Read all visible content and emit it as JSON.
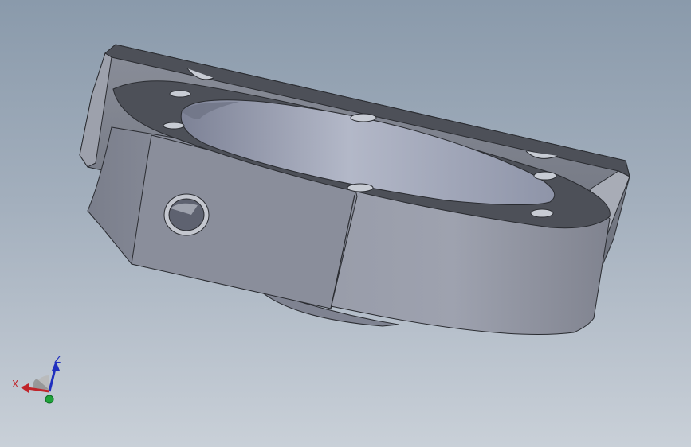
{
  "viewport": {
    "background_top": "#8a9aab",
    "background_bottom": "#c9d0d8"
  },
  "part": {
    "body_color": "#8b8f9c",
    "top_face_color": "#4d5058",
    "bore_color": "#9aa0b3",
    "edge_color": "#2a2c31"
  },
  "triad": {
    "x_label": "X",
    "z_label": "Z",
    "x_color": "#c0242a",
    "z_color": "#1f2fbf",
    "y_color": "#1fa33a"
  }
}
